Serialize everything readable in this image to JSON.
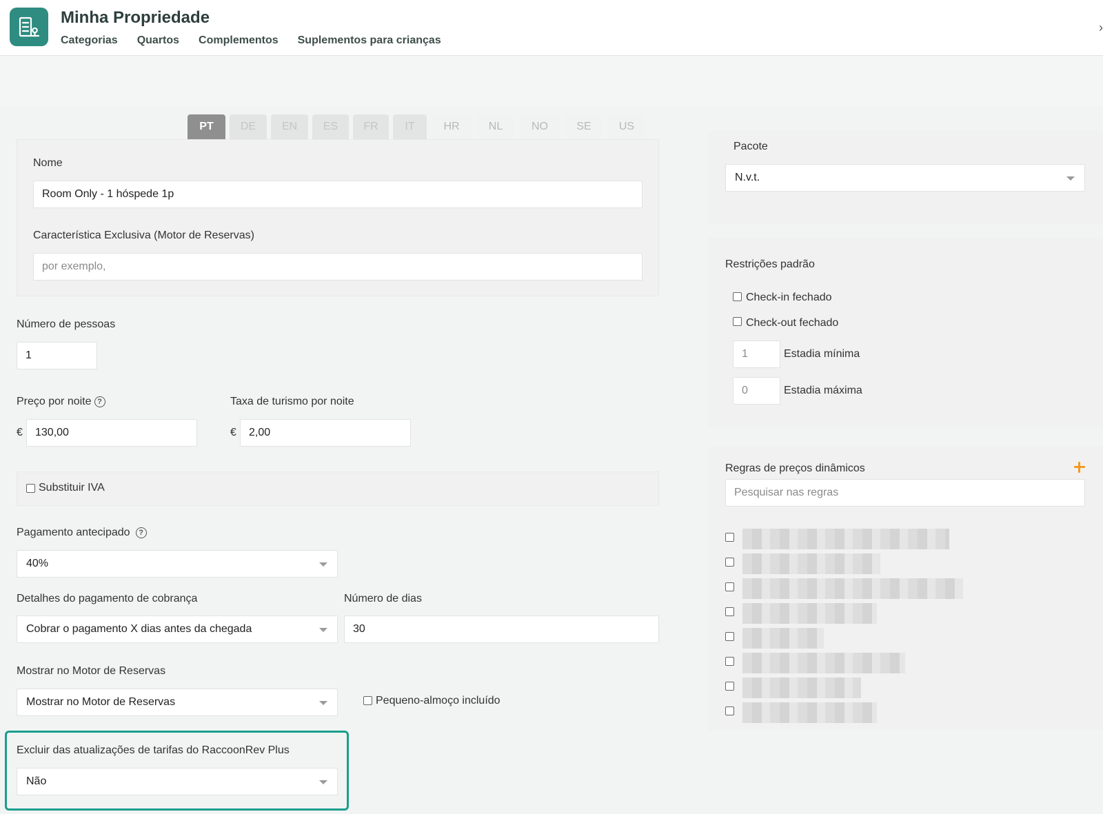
{
  "header": {
    "title": "Minha Propriedade",
    "nav": [
      "Categorias",
      "Quartos",
      "Complementos",
      "Suplementos para crianças"
    ],
    "edge_glyph": "›"
  },
  "languages": [
    {
      "code": "PT",
      "state": "active"
    },
    {
      "code": "DE",
      "state": "filled"
    },
    {
      "code": "EN",
      "state": "filled"
    },
    {
      "code": "ES",
      "state": "filled"
    },
    {
      "code": "FR",
      "state": "filled"
    },
    {
      "code": "IT",
      "state": "filled"
    },
    {
      "code": "HR",
      "state": "plain"
    },
    {
      "code": "NL",
      "state": "plain"
    },
    {
      "code": "NO",
      "state": "plain"
    },
    {
      "code": "SE",
      "state": "plain"
    },
    {
      "code": "US",
      "state": "plain"
    }
  ],
  "form": {
    "name_label": "Nome",
    "name_value": "Room Only - 1 hóspede 1p",
    "feature_label": "Característica Exclusiva (Motor de Reservas)",
    "feature_placeholder": "por exemplo,",
    "persons_label": "Número de pessoas",
    "persons_value": "1",
    "price_label": "Preço por noite",
    "price_currency": "€",
    "price_value": "130,00",
    "tax_label": "Taxa de turismo por noite",
    "tax_currency": "€",
    "tax_value": "2,00",
    "vat_label": "Substituir IVA",
    "prepay_label": "Pagamento antecipado",
    "prepay_value": "40%",
    "charge_label": "Detalhes do pagamento de cobrança",
    "charge_value": "Cobrar o pagamento X dias antes da chegada",
    "days_label": "Número de dias",
    "days_value": "30",
    "show_label": "Mostrar no Motor de Reservas",
    "show_value": "Mostrar no Motor de Reservas",
    "breakfast_label": "Pequeno-almoço incluído",
    "exclude_label": "Excluir das atualizações de tarifas do RaccoonRev Plus",
    "exclude_value": "Não",
    "help_glyph": "?"
  },
  "sidebar": {
    "package_label": "Pacote",
    "package_value": "N.v.t.",
    "restrictions_title": "Restrições padrão",
    "checkin_closed": "Check-in fechado",
    "checkout_closed": "Check-out fechado",
    "min_stay_value": "1",
    "min_stay_label": "Estadia mínima",
    "max_stay_value": "0",
    "max_stay_label": "Estadia máxima",
    "rules_title": "Regras de preços dinâmicos",
    "rules_search_placeholder": "Pesquisar nas regras",
    "rules_count_visible": 8
  },
  "colors": {
    "brand": "#2e8c80",
    "highlight": "#1a9e8c",
    "add_accent": "#f39a1e"
  }
}
